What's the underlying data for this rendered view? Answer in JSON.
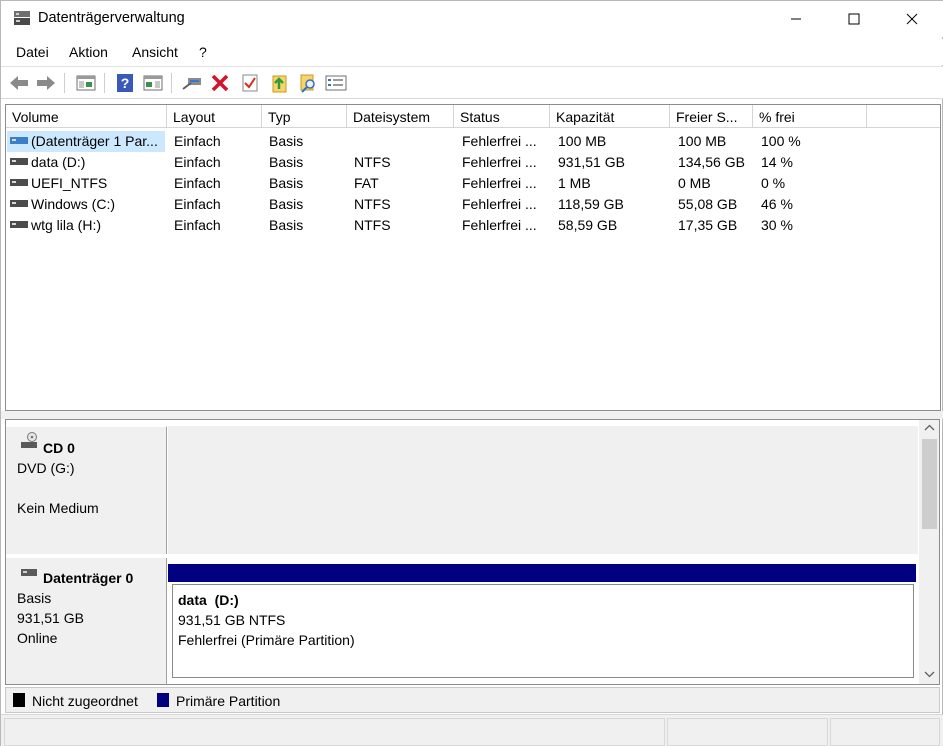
{
  "window": {
    "title": "Datenträgerverwaltung"
  },
  "menu": [
    "Datei",
    "Aktion",
    "Ansicht",
    "?"
  ],
  "toolbar_icons": [
    "back-arrow-icon",
    "forward-arrow-icon",
    "console-tree-icon",
    "help-icon",
    "action-pane-icon",
    "connect-disk-icon",
    "delete-icon",
    "checklist-icon",
    "export-icon",
    "search-icon",
    "properties-icon"
  ],
  "columns": [
    "Volume",
    "Layout",
    "Typ",
    "Dateisystem",
    "Status",
    "Kapazität",
    "Freier S...",
    "% frei"
  ],
  "volumes": [
    {
      "volume": "(Datenträger 1 Par...",
      "layout": "Einfach",
      "typ": "Basis",
      "fs": "",
      "status": "Fehlerfrei ...",
      "capacity": "100 MB",
      "free": "100 MB",
      "pct": "100 %"
    },
    {
      "volume": "data (D:)",
      "layout": "Einfach",
      "typ": "Basis",
      "fs": "NTFS",
      "status": "Fehlerfrei ...",
      "capacity": "931,51 GB",
      "free": "134,56 GB",
      "pct": "14 %"
    },
    {
      "volume": "UEFI_NTFS",
      "layout": "Einfach",
      "typ": "Basis",
      "fs": "FAT",
      "status": "Fehlerfrei ...",
      "capacity": "1 MB",
      "free": "0 MB",
      "pct": "0 %"
    },
    {
      "volume": "Windows (C:)",
      "layout": "Einfach",
      "typ": "Basis",
      "fs": "NTFS",
      "status": "Fehlerfrei ...",
      "capacity": "118,59 GB",
      "free": "55,08 GB",
      "pct": "46 %"
    },
    {
      "volume": "wtg lila (H:)",
      "layout": "Einfach",
      "typ": "Basis",
      "fs": "NTFS",
      "status": "Fehlerfrei ...",
      "capacity": "58,59 GB",
      "free": "17,35 GB",
      "pct": "30 %"
    }
  ],
  "disks": {
    "cd0": {
      "name": "CD 0",
      "type": "DVD (G:)",
      "media": "Kein Medium"
    },
    "disk0": {
      "name": "Datenträger 0",
      "type": "Basis",
      "size": "931,51 GB",
      "state": "Online",
      "partition": {
        "title": "data  (D:)",
        "size_fs": "931,51 GB NTFS",
        "status": "Fehlerfrei (Primäre Partition)"
      }
    }
  },
  "legend": [
    {
      "label": "Nicht zugeordnet",
      "color": "#000000"
    },
    {
      "label": "Primäre Partition",
      "color": "#000080"
    }
  ],
  "colors": {
    "primary_partition": "#000080",
    "selection": "#cce8ff"
  }
}
